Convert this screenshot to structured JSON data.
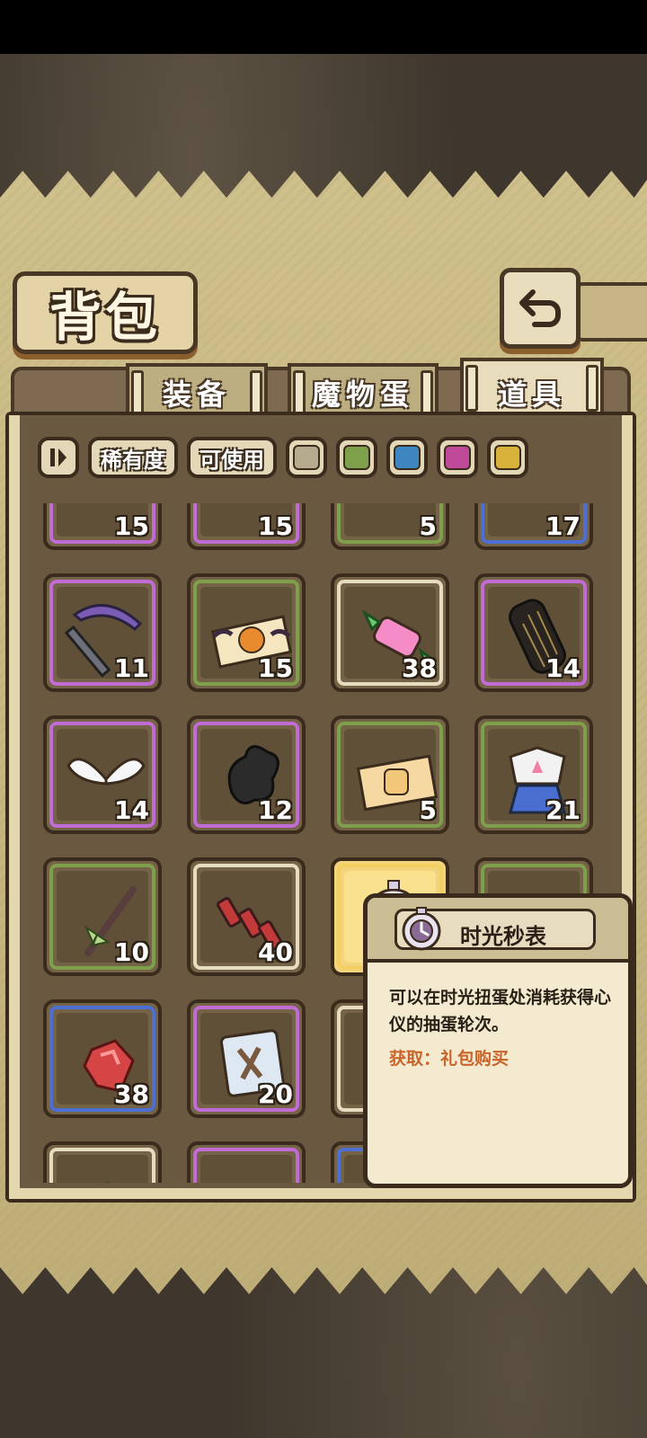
{
  "title": "背包",
  "tabs": [
    {
      "label": "装备",
      "active": false
    },
    {
      "label": "魔物蛋",
      "active": false
    },
    {
      "label": "道具",
      "active": true
    }
  ],
  "filters": {
    "rarity_label": "稀有度",
    "usable_label": "可使用",
    "colors": [
      "#b5ab8f",
      "#7fa04a",
      "#3e86bf",
      "#c04a9a",
      "#d8b23a"
    ]
  },
  "rarity_colors": {
    "gray": "#e6dcc1",
    "green": "#7fa04a",
    "blue": "#4d6fd3",
    "purple": "#c26ad6",
    "gold": "#f2d063"
  },
  "items": [
    {
      "icon": "bat-creature-icon",
      "count": "15",
      "rarity": "purple"
    },
    {
      "icon": "white-egg-icon",
      "count": "15",
      "rarity": "purple"
    },
    {
      "icon": "metal-tool-icon",
      "count": "5",
      "rarity": "green"
    },
    {
      "icon": "blue-tube-icon",
      "count": "17",
      "rarity": "blue"
    },
    {
      "icon": "pickaxe-icon",
      "count": "11",
      "rarity": "purple"
    },
    {
      "icon": "pumpkin-ticket-icon",
      "count": "15",
      "rarity": "green"
    },
    {
      "icon": "rainbow-candy-icon",
      "count": "38",
      "rarity": "gray"
    },
    {
      "icon": "black-grill-cylinder-icon",
      "count": "14",
      "rarity": "purple"
    },
    {
      "icon": "white-wings-icon",
      "count": "14",
      "rarity": "purple"
    },
    {
      "icon": "black-smoke-icon",
      "count": "12",
      "rarity": "purple"
    },
    {
      "icon": "character-ticket-icon",
      "count": "5",
      "rarity": "green"
    },
    {
      "icon": "sailor-uniform-icon",
      "count": "21",
      "rarity": "green"
    },
    {
      "icon": "branch-ribbon-icon",
      "count": "10",
      "rarity": "green"
    },
    {
      "icon": "firecracker-icon",
      "count": "40",
      "rarity": "gray"
    },
    {
      "icon": "stopwatch-icon",
      "count": "",
      "rarity": "gold",
      "selected": true
    },
    {
      "icon": "hidden-item-icon",
      "count": "",
      "rarity": "green"
    },
    {
      "icon": "red-gem-icon",
      "count": "38",
      "rarity": "blue"
    },
    {
      "icon": "ice-cube-icon",
      "count": "20",
      "rarity": "purple"
    },
    {
      "icon": "hidden-item-icon",
      "count": "",
      "rarity": "gray"
    },
    {
      "icon": "hidden-item-icon",
      "count": "",
      "rarity": "purple"
    },
    {
      "icon": "green-sprout-icon",
      "count": "",
      "rarity": "gray"
    },
    {
      "icon": "hidden-item-icon",
      "count": "",
      "rarity": "purple"
    },
    {
      "icon": "hidden-item-icon",
      "count": "",
      "rarity": "blue"
    },
    {
      "icon": "hidden-item-icon",
      "count": "",
      "rarity": "purple"
    }
  ],
  "tooltip": {
    "name": "时光秒表",
    "description": "可以在时光扭蛋处消耗获得心仪的抽蛋轮次。",
    "source_label": "获取：",
    "source_value": "礼包购买"
  }
}
